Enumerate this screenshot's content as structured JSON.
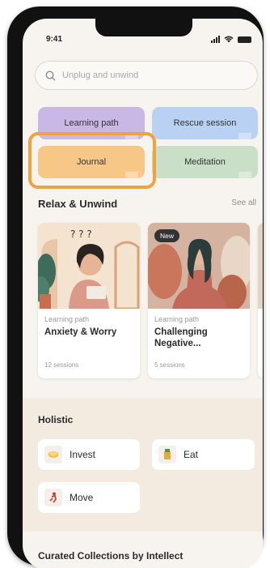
{
  "status": {
    "time": "9:41"
  },
  "search": {
    "placeholder": "Unplug and unwind"
  },
  "quick_actions": [
    {
      "label": "Learning path",
      "color": "#c9b8e6"
    },
    {
      "label": "Rescue session",
      "color": "#b9d2f3"
    },
    {
      "label": "Journal",
      "color": "#f7c788"
    },
    {
      "label": "Meditation",
      "color": "#c9dfc7"
    }
  ],
  "highlight_color": "#f0a241",
  "relax": {
    "title": "Relax & Unwind",
    "see_all": "See all",
    "cards": [
      {
        "type": "Learning path",
        "title": "Anxiety & Worry",
        "sessions": "12 sessions"
      },
      {
        "badge": "New",
        "type": "Learning path",
        "title": "Challenging Negative...",
        "sessions": "5 sessions"
      },
      {
        "type": "L",
        "title": "F",
        "sessions": ""
      }
    ]
  },
  "holistic": {
    "title": "Holistic",
    "items": [
      {
        "label": "Invest",
        "icon": "coin-icon"
      },
      {
        "label": "Eat",
        "icon": "food-icon"
      },
      {
        "label": "Move",
        "icon": "running-icon"
      }
    ]
  },
  "curated": {
    "title": "Curated Collections by Intellect"
  }
}
